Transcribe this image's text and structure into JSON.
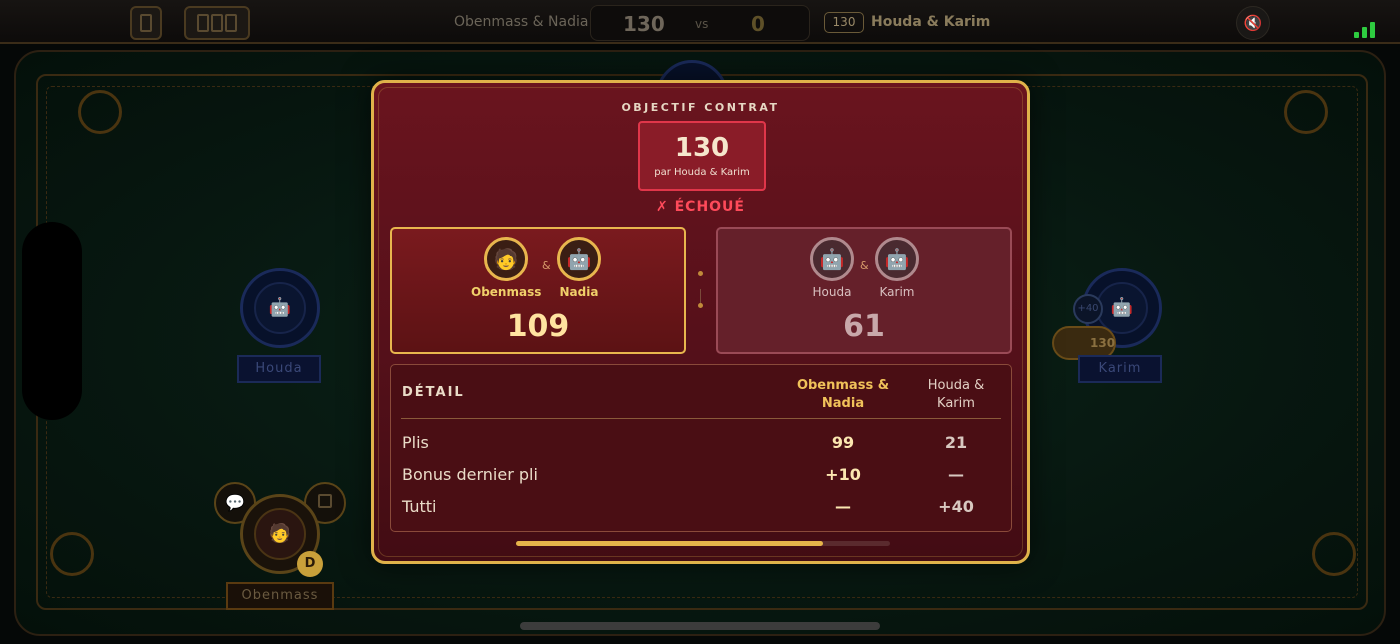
{
  "topbar": {
    "team_left": "Obenmass & Nadia",
    "score_left": "130",
    "vs": "vs",
    "score_right": "0",
    "bid_chip": "130",
    "team_right": "Houda & Karim"
  },
  "table": {
    "seat_left_name": "Houda",
    "seat_right_name": "Karim",
    "seat_bottom_name": "Obenmass",
    "right_mini_chip": "+40",
    "bid_token": "130",
    "dealer_badge": "D"
  },
  "modal": {
    "objective_title": "OBJECTIF CONTRAT",
    "contract_value": "130",
    "contract_by": "par Houda & Karim",
    "result": "✗ ÉCHOUÉ",
    "team_a": {
      "player1": "Obenmass",
      "player2": "Nadia",
      "ampersand": "&",
      "score": "109"
    },
    "team_b": {
      "player1": "Houda",
      "player2": "Karim",
      "ampersand": "&",
      "score": "61"
    },
    "detail": {
      "heading": "DÉTAIL",
      "col1_line1": "Obenmass &",
      "col1_line2": "Nadia",
      "col2_line1": "Houda &",
      "col2_line2": "Karim",
      "rows": [
        {
          "label": "Plis",
          "a": "99",
          "b": "21"
        },
        {
          "label": "Bonus dernier pli",
          "a": "+10",
          "b": "—"
        },
        {
          "label": "Tutti",
          "a": "—",
          "b": "+40"
        }
      ]
    },
    "progress_fraction": 0.82
  },
  "icons": {
    "player_face": "🧑",
    "robot": "🤖",
    "chat": "💬",
    "mute": "🔇"
  },
  "colors": {
    "accent_gold": "#e0b24a",
    "modal_bg": "#5a1018",
    "fail_red": "#ff4a5a",
    "signal_green": "#2ecc40"
  }
}
